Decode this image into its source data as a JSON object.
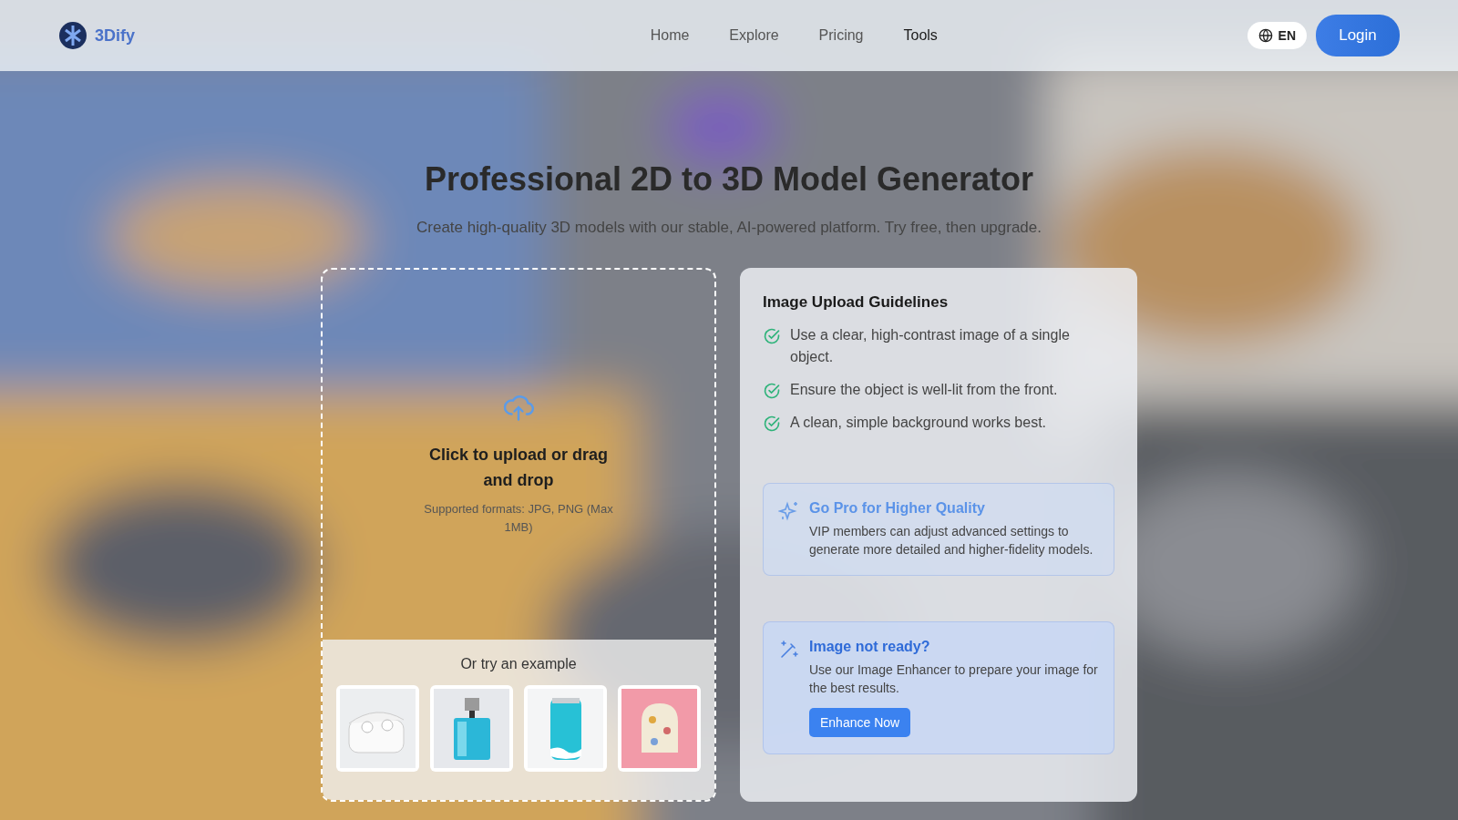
{
  "header": {
    "brand": "3Dify",
    "nav": [
      {
        "label": "Home",
        "selected": false
      },
      {
        "label": "Explore",
        "selected": false
      },
      {
        "label": "Pricing",
        "selected": false
      },
      {
        "label": "Tools",
        "selected": true
      }
    ],
    "language": "EN",
    "login": "Login"
  },
  "hero": {
    "title": "Professional 2D to 3D Model Generator",
    "subtitle": "Create high-quality 3D models with our stable, AI-powered platform. Try free, then upgrade."
  },
  "upload": {
    "title": "Click to upload or drag and drop",
    "formats": "Supported formats: JPG, PNG (Max 1MB)",
    "examples_label": "Or try an example"
  },
  "guidelines": {
    "title": "Image Upload Guidelines",
    "items": [
      "Use a clear, high-contrast image of a single object.",
      "Ensure the object is well-lit from the front.",
      "A clean, simple background works best."
    ]
  },
  "pro_box": {
    "title": "Go Pro for Higher Quality",
    "text": "VIP members can adjust advanced settings to generate more detailed and higher-fidelity models."
  },
  "enhance_box": {
    "title": "Image not ready?",
    "text": "Use our Image Enhancer to prepare your image for the best results.",
    "button": "Enhance Now"
  }
}
